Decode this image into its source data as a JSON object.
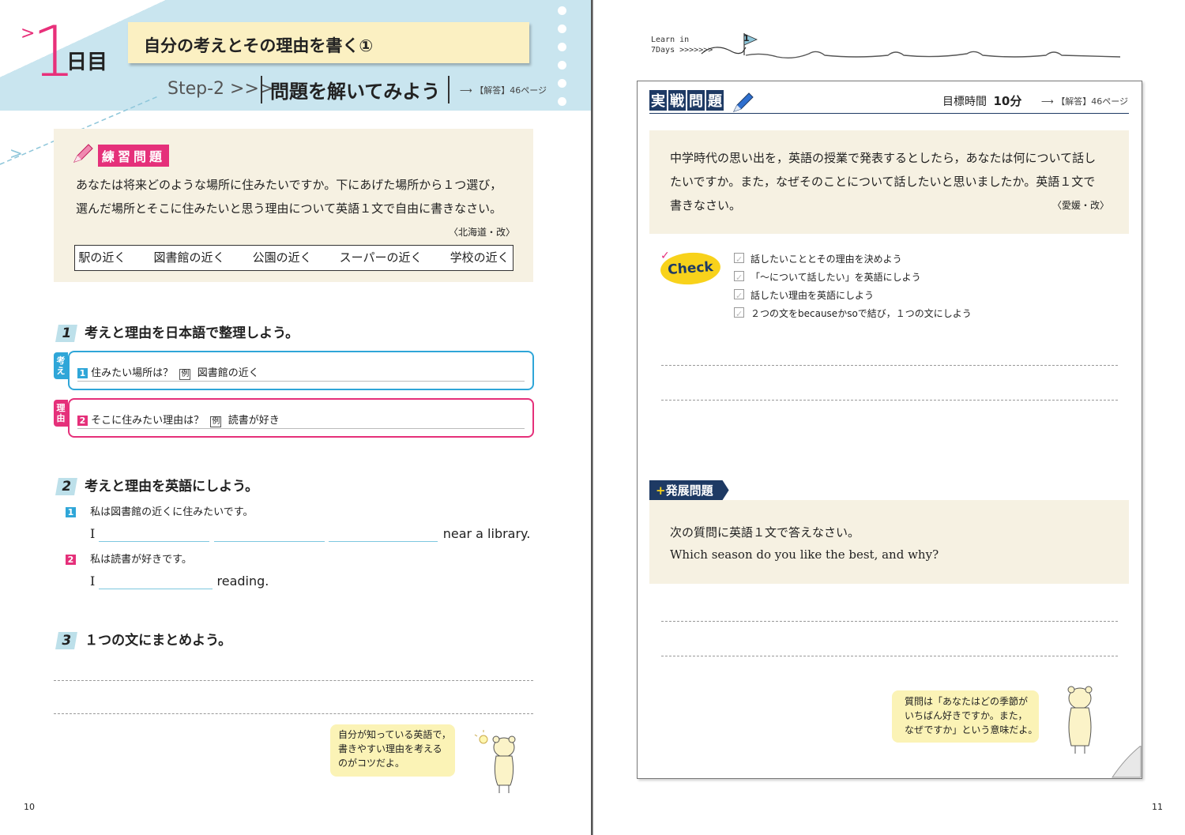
{
  "left": {
    "day": {
      "number": "1",
      "label": "日目"
    },
    "title": "自分の考えとその理由を書く①",
    "step": {
      "label": "Step-2 >>>",
      "title": "問題を解いてみよう",
      "answer_ref_prefix": "【解答】",
      "answer_ref": "46ページ"
    },
    "practice": {
      "tag": "練習問題",
      "line1": "あなたは将来どのような場所に住みたいですか。下にあげた場所から１つ選び，",
      "line2": "選んだ場所とそこに住みたいと思う理由について英語１文で自由に書きなさい。",
      "source": "〈北海道・改〉",
      "options": [
        "駅の近く",
        "図書館の近く",
        "公園の近く",
        "スーパーの近く",
        "学校の近く"
      ]
    },
    "section1": {
      "num": "1",
      "title": "考えと理由を日本語で整理しよう。",
      "idea": {
        "tab": "考え",
        "n": "1",
        "question": "住みたい場所は？",
        "rei": "例",
        "example": "図書館の近く"
      },
      "reason": {
        "tab": "理由",
        "n": "2",
        "question": "そこに住みたい理由は？",
        "rei": "例",
        "example": "読書が好き"
      }
    },
    "section2": {
      "num": "2",
      "title": "考えと理由を英語にしよう。",
      "q1": {
        "n": "1",
        "text": "私は図書館の近くに住みたいです。",
        "start": "I",
        "end": "near a library."
      },
      "q2": {
        "n": "2",
        "text": "私は読書が好きです。",
        "start": "I",
        "end": "reading."
      }
    },
    "section3": {
      "num": "3",
      "title": "１つの文にまとめよう。"
    },
    "bubble": [
      "自分が知っている英語で，",
      "書きやすい理由を考える",
      "のがコツだよ。"
    ],
    "page_number": "10"
  },
  "right": {
    "logo": {
      "line1": "Learn in",
      "line2": "7Days >>>>>>>",
      "flag": "1"
    },
    "jissen_tag": [
      "実",
      "戦",
      "問",
      "題"
    ],
    "target_time": {
      "label": "目標時間",
      "value": "10分"
    },
    "answer_ref_prefix": "【解答】",
    "answer_ref": "46ページ",
    "question": {
      "line1": "中学時代の思い出を，英語の授業で発表するとしたら，あなたは何について話し",
      "line2": "たいですか。また，なぜそのことについて話したいと思いましたか。英語１文で",
      "line3": "書きなさい。",
      "source": "〈愛媛・改〉"
    },
    "check": {
      "badge": "Check",
      "items": [
        "話したいこととその理由を決めよう",
        "「～について話したい」を英語にしよう",
        "話したい理由を英語にしよう",
        "２つの文をbecauseかsoで結び，１つの文にしよう"
      ]
    },
    "development": {
      "tag": "発展問題",
      "line1": "次の質問に英語１文で答えなさい。",
      "line2": "Which season do you like the best, and why?"
    },
    "bubble": [
      "質問は「あなたはどの季節が",
      "いちばん好きですか。また，",
      "なぜですか」という意味だよ。"
    ],
    "page_number": "11"
  },
  "colors": {
    "pink": "#e5307a",
    "blue": "#2fa6d8",
    "navy": "#1e3a64",
    "header": "#c9e5ef",
    "beige": "#f6f1e2",
    "note": "#fbf0c2"
  }
}
